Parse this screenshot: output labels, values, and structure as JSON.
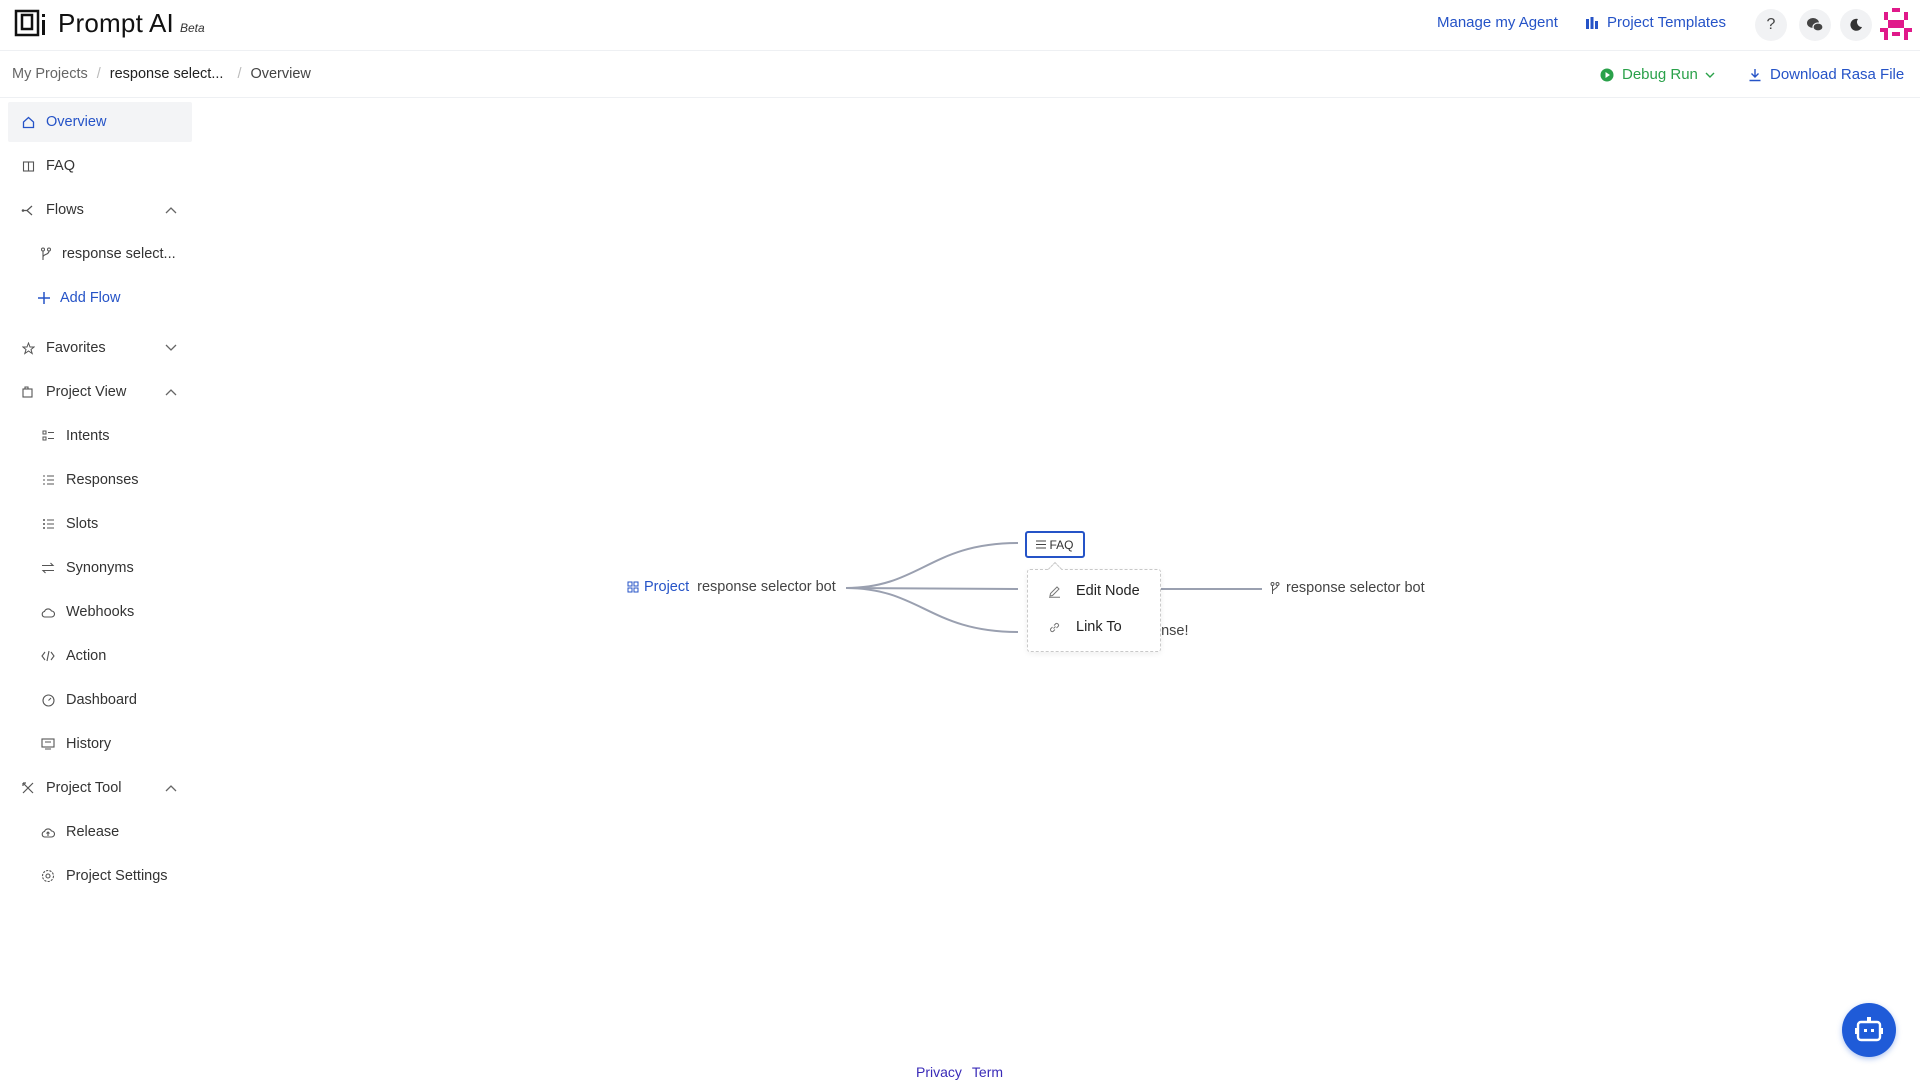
{
  "header": {
    "app_name": "Prompt AI",
    "beta_label": "Beta",
    "manage_agent": "Manage my Agent",
    "project_templates": "Project Templates",
    "icons": [
      "logo-icon",
      "templates-icon",
      "help-icon",
      "wechat-icon",
      "moon-icon",
      "avatar-icon"
    ]
  },
  "breadcrumb": {
    "items": [
      "My Projects",
      "response select...",
      "Overview"
    ],
    "separator": "/"
  },
  "toolbar": {
    "debug_run": "Debug Run",
    "download_rasa": "Download Rasa File"
  },
  "sidebar": {
    "overview": "Overview",
    "faq": "FAQ",
    "flows": "Flows",
    "flow_item": "response select...",
    "add_flow": "Add Flow",
    "favorites": "Favorites",
    "project_view": "Project View",
    "intents": "Intents",
    "responses": "Responses",
    "slots": "Slots",
    "synonyms": "Synonyms",
    "webhooks": "Webhooks",
    "action": "Action",
    "dashboard": "Dashboard",
    "history": "History",
    "project_tool": "Project Tool",
    "release": "Release",
    "project_settings": "Project Settings"
  },
  "mindmap": {
    "root_tag": "Project",
    "root_name": "response selector bot",
    "faq_node": "FAQ",
    "flow_node": "response selector bot",
    "hidden_node_tail": "onse!"
  },
  "context_menu": {
    "edit_node": "Edit Node",
    "link_to": "Link To"
  },
  "footer": {
    "privacy": "Privacy",
    "term": "Term"
  },
  "colors": {
    "accent": "#2553c7",
    "debug_green": "#2aa14a",
    "bot_button": "#1f5bd8",
    "avatar": "#e0198a"
  }
}
